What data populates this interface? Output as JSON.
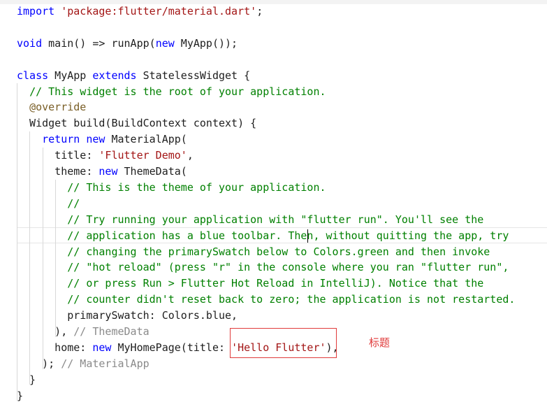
{
  "lines": [
    [
      {
        "c": "kw",
        "t": "import"
      },
      {
        "c": "txt",
        "t": " "
      },
      {
        "c": "str",
        "t": "'package:flutter/material.dart'"
      },
      {
        "c": "txt",
        "t": ";"
      }
    ],
    [],
    [
      {
        "c": "kw",
        "t": "void"
      },
      {
        "c": "txt",
        "t": " main() => runApp("
      },
      {
        "c": "kw",
        "t": "new"
      },
      {
        "c": "txt",
        "t": " MyApp());"
      }
    ],
    [],
    [
      {
        "c": "kw",
        "t": "class"
      },
      {
        "c": "txt",
        "t": " MyApp "
      },
      {
        "c": "kw",
        "t": "extends"
      },
      {
        "c": "txt",
        "t": " StatelessWidget {"
      }
    ],
    [
      {
        "c": "txt",
        "t": "  "
      },
      {
        "c": "cmt",
        "t": "// This widget is the root of your application."
      }
    ],
    [
      {
        "c": "txt",
        "t": "  "
      },
      {
        "c": "ann",
        "t": "@override"
      }
    ],
    [
      {
        "c": "txt",
        "t": "  Widget build(BuildContext context) {"
      }
    ],
    [
      {
        "c": "txt",
        "t": "    "
      },
      {
        "c": "kw",
        "t": "return"
      },
      {
        "c": "txt",
        "t": " "
      },
      {
        "c": "kw",
        "t": "new"
      },
      {
        "c": "txt",
        "t": " MaterialApp("
      }
    ],
    [
      {
        "c": "txt",
        "t": "      title: "
      },
      {
        "c": "str",
        "t": "'Flutter Demo'"
      },
      {
        "c": "txt",
        "t": ","
      }
    ],
    [
      {
        "c": "txt",
        "t": "      theme: "
      },
      {
        "c": "kw",
        "t": "new"
      },
      {
        "c": "txt",
        "t": " ThemeData("
      }
    ],
    [
      {
        "c": "txt",
        "t": "        "
      },
      {
        "c": "cmt",
        "t": "// This is the theme of your application."
      }
    ],
    [
      {
        "c": "txt",
        "t": "        "
      },
      {
        "c": "cmt",
        "t": "//"
      }
    ],
    [
      {
        "c": "txt",
        "t": "        "
      },
      {
        "c": "cmt",
        "t": "// Try running your application with \"flutter run\". You'll see the"
      }
    ],
    [
      {
        "c": "txt",
        "t": "        "
      },
      {
        "c": "cmt",
        "t": "// application has a blue toolbar. Then, without quitting the app, try"
      }
    ],
    [
      {
        "c": "txt",
        "t": "        "
      },
      {
        "c": "cmt",
        "t": "// changing the primarySwatch below to Colors.green and then invoke"
      }
    ],
    [
      {
        "c": "txt",
        "t": "        "
      },
      {
        "c": "cmt",
        "t": "// \"hot reload\" (press \"r\" in the console where you ran \"flutter run\","
      }
    ],
    [
      {
        "c": "txt",
        "t": "        "
      },
      {
        "c": "cmt",
        "t": "// or press Run > Flutter Hot Reload in IntelliJ). Notice that the"
      }
    ],
    [
      {
        "c": "txt",
        "t": "        "
      },
      {
        "c": "cmt",
        "t": "// counter didn't reset back to zero; the application is not restarted."
      }
    ],
    [
      {
        "c": "txt",
        "t": "        primarySwatch: Colors.blue,"
      }
    ],
    [
      {
        "c": "txt",
        "t": "      ), "
      },
      {
        "c": "cmtv",
        "t": "// ThemeData"
      }
    ],
    [
      {
        "c": "txt",
        "t": "      home: "
      },
      {
        "c": "kw",
        "t": "new"
      },
      {
        "c": "txt",
        "t": " MyHomePage(title: "
      },
      {
        "c": "str",
        "t": "'Hello Flutter'"
      },
      {
        "c": "txt",
        "t": "),"
      }
    ],
    [
      {
        "c": "txt",
        "t": "    ); "
      },
      {
        "c": "cmtv",
        "t": "// MaterialApp"
      }
    ],
    [
      {
        "c": "txt",
        "t": "  }"
      }
    ],
    [
      {
        "c": "txt",
        "t": "}"
      }
    ]
  ],
  "annotation": {
    "label": "标题"
  },
  "colors": {
    "keyword": "#0000ff",
    "string": "#a31515",
    "comment": "#008000",
    "annotation_box": "#e03b3b"
  }
}
